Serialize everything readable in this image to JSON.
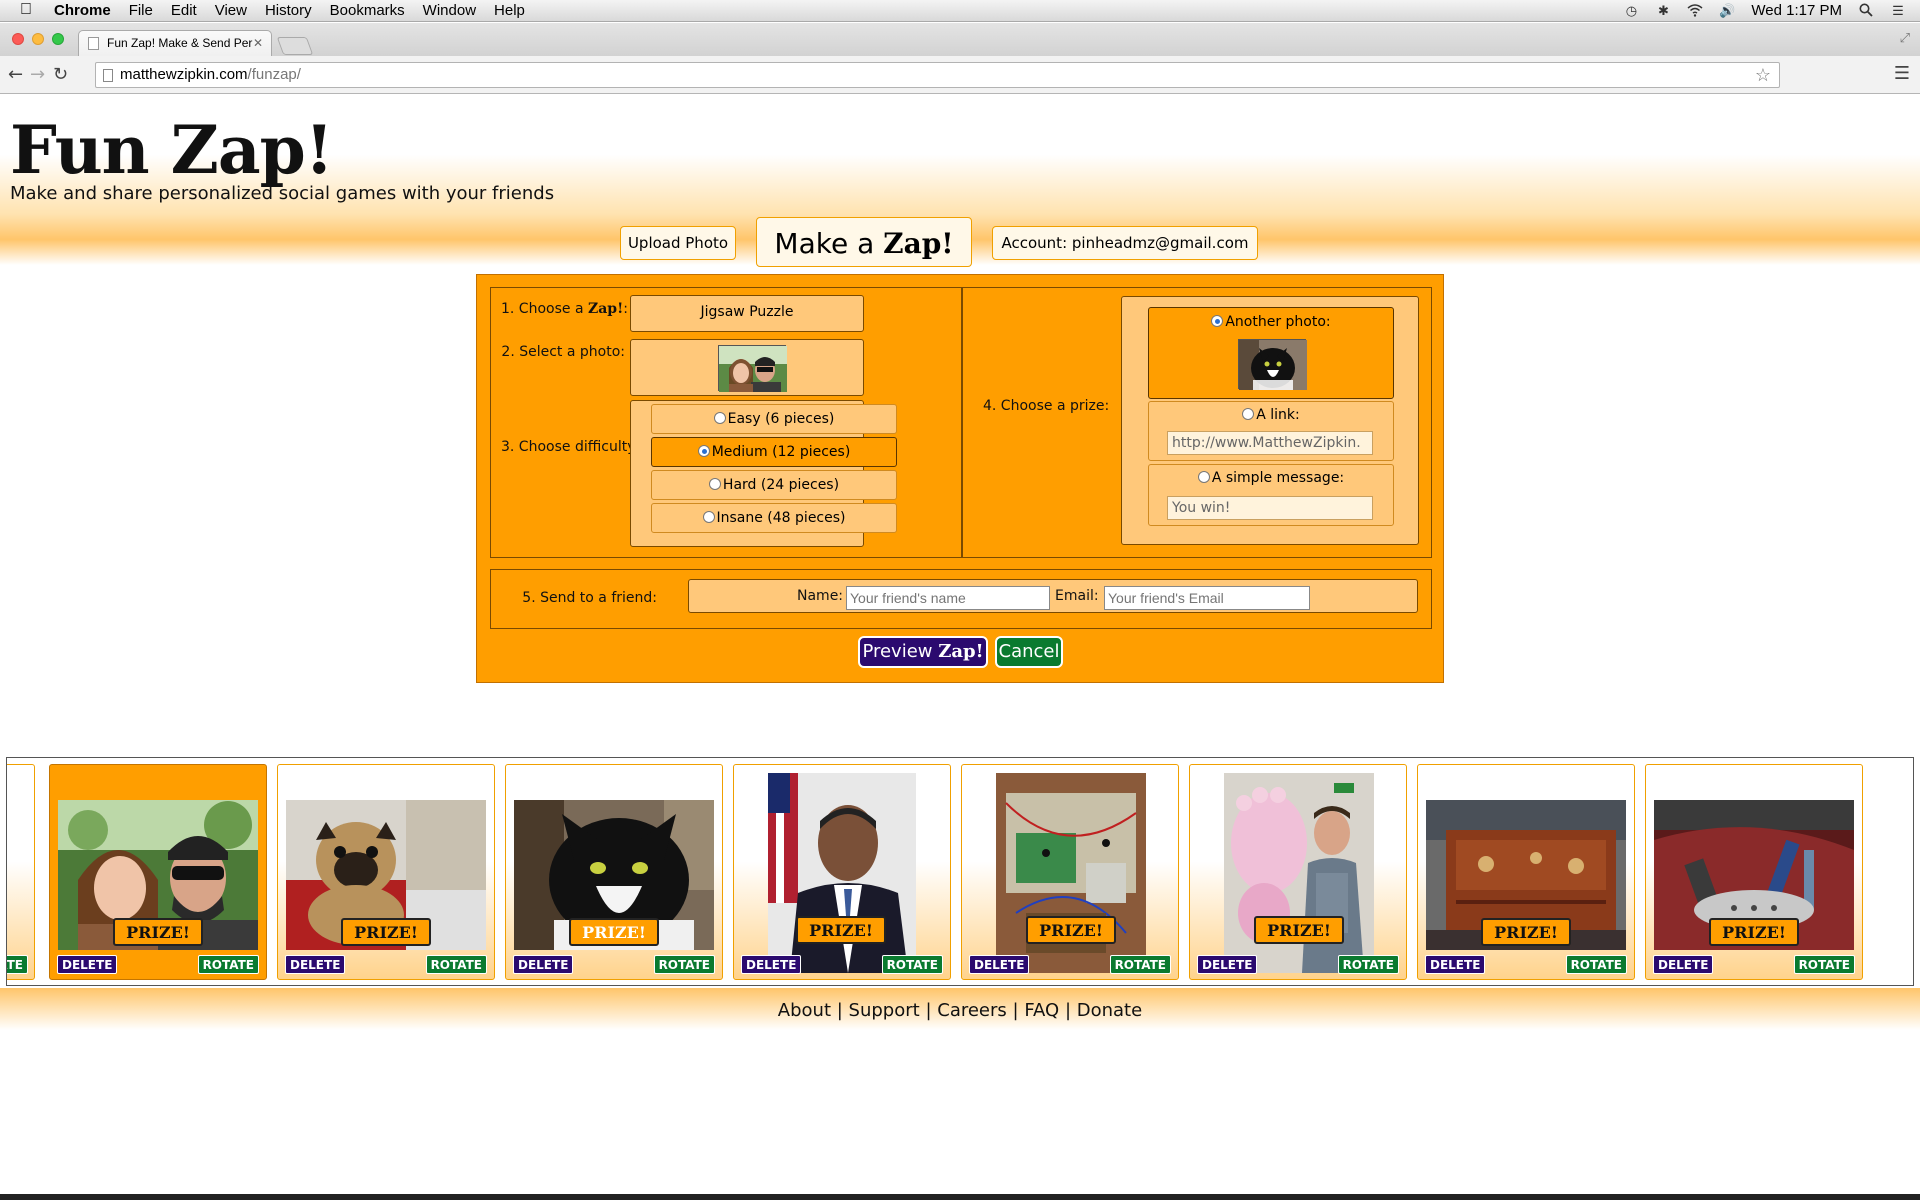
{
  "menubar": {
    "app": "Chrome",
    "menus": [
      "File",
      "Edit",
      "View",
      "History",
      "Bookmarks",
      "Window",
      "Help"
    ],
    "clock": "Wed 1:17 PM"
  },
  "browser": {
    "tab_title": "Fun Zap! Make & Send Per",
    "url_host": "matthewzipkin.com",
    "url_path": "/funzap/"
  },
  "header": {
    "logo": "Fun Zap!",
    "tagline": "Make and share personalized social games with your friends"
  },
  "top_buttons": {
    "upload": "Upload Photo",
    "make_prefix": "Make a",
    "make_brand": "Zap!",
    "account": "Account: pinheadmz@gmail.com"
  },
  "form": {
    "step1_prefix": "1. Choose a",
    "step1_brand": "Zap!",
    "step1_suffix": ":",
    "zap_type": "Jigsaw Puzzle",
    "step2": "2. Select a photo:",
    "step3": "3. Choose difficulty:",
    "difficulty_options": [
      {
        "label": "Easy (6 pieces)",
        "selected": false
      },
      {
        "label": "Medium (12 pieces)",
        "selected": true
      },
      {
        "label": "Hard (24 pieces)",
        "selected": false
      },
      {
        "label": "Insane (48 pieces)",
        "selected": false
      }
    ],
    "step4": "4. Choose a prize:",
    "prize_photo_label": "Another photo:",
    "prize_link_label": "A link:",
    "prize_link_value": "http://www.MatthewZipkin.",
    "prize_message_label": "A simple message:",
    "prize_message_value": "You win!",
    "step5": "5. Send to a friend:",
    "name_label": "Name:",
    "name_placeholder": "Your friend's name",
    "email_label": "Email:",
    "email_placeholder": "Your friend's Email",
    "preview_prefix": "Preview",
    "preview_brand": "Zap!",
    "cancel": "Cancel"
  },
  "gallery": {
    "prize_label": "PRIZE!",
    "delete_label": "DELETE",
    "rotate_label": "ROTATE",
    "partial_rotate": "TATE",
    "items": [
      "couple-selfie",
      "pug",
      "tuxedo-cat",
      "portrait",
      "electronics",
      "balloon-party",
      "wooden-box",
      "tools-bag"
    ]
  },
  "footer": {
    "links": [
      "About",
      "Support",
      "Careers",
      "FAQ",
      "Donate"
    ],
    "separator": "|"
  }
}
